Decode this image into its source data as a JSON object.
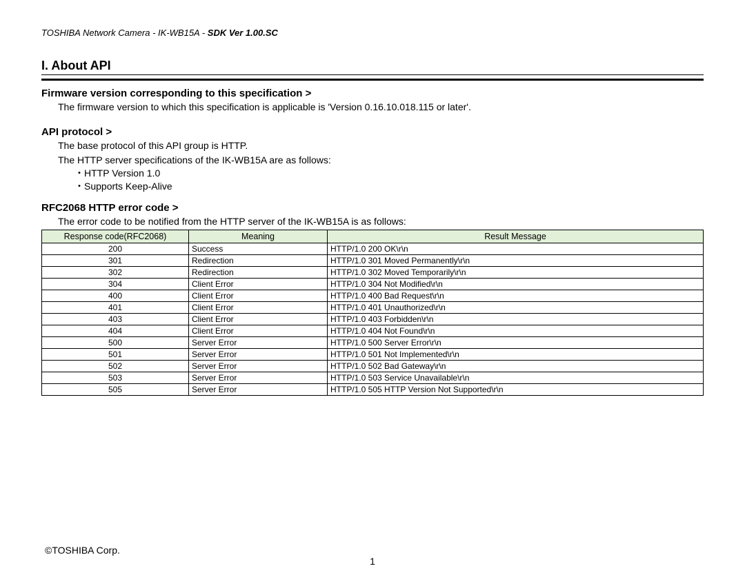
{
  "header": {
    "prefix": "TOSHIBA Network Camera - IK-WB15A -    ",
    "sdk_label": "SDK ",
    "sdk_version": "Ver 1.00.SC"
  },
  "chapter": {
    "title": "I.   About API"
  },
  "sections": {
    "firmware": {
      "title": "Firmware version corresponding to this specification >",
      "text": "The firmware version to which this specification is applicable is 'Version 0.16.10.018.115 or later'."
    },
    "api_protocol": {
      "title": "API protocol >",
      "line1": "The base protocol of this API group is HTTP.",
      "line2": "The HTTP server specifications of the IK-WB15A are as follows:",
      "bullet1": "・HTTP Version 1.0",
      "bullet2": "・Supports Keep-Alive"
    },
    "rfc2068": {
      "title": "RFC2068 HTTP error code >",
      "intro": "The error code to be notified from the HTTP server of the IK-WB15A is as follows:"
    }
  },
  "table": {
    "headers": [
      "Response code(RFC2068)",
      "Meaning",
      "Result Message"
    ],
    "rows": [
      {
        "code": "200",
        "meaning": "Success",
        "msg": "HTTP/1.0 200 OK\\r\\n"
      },
      {
        "code": "301",
        "meaning": "Redirection",
        "msg": "HTTP/1.0 301 Moved Permanently\\r\\n"
      },
      {
        "code": "302",
        "meaning": "Redirection",
        "msg": "HTTP/1.0 302 Moved Temporarily\\r\\n"
      },
      {
        "code": "304",
        "meaning": "Client Error",
        "msg": "HTTP/1.0 304 Not Modified\\r\\n"
      },
      {
        "code": "400",
        "meaning": "Client Error",
        "msg": "HTTP/1.0 400 Bad Request\\r\\n"
      },
      {
        "code": "401",
        "meaning": "Client Error",
        "msg": "HTTP/1.0 401 Unauthorized\\r\\n"
      },
      {
        "code": "403",
        "meaning": "Client Error",
        "msg": "HTTP/1.0 403 Forbidden\\r\\n"
      },
      {
        "code": "404",
        "meaning": "Client Error",
        "msg": "HTTP/1.0 404 Not Found\\r\\n"
      },
      {
        "code": "500",
        "meaning": "Server Error",
        "msg": "HTTP/1.0 500 Server Error\\r\\n"
      },
      {
        "code": "501",
        "meaning": "Server Error",
        "msg": "HTTP/1.0 501 Not Implemented\\r\\n"
      },
      {
        "code": "502",
        "meaning": "Server Error",
        "msg": "HTTP/1.0 502 Bad Gateway\\r\\n"
      },
      {
        "code": "503",
        "meaning": "Server Error",
        "msg": "HTTP/1.0 503 Service Unavailable\\r\\n"
      },
      {
        "code": "505",
        "meaning": "Server Error",
        "msg": "HTTP/1.0 505 HTTP Version Not Supported\\r\\n"
      }
    ]
  },
  "footer": {
    "copyright": "©TOSHIBA Corp.",
    "page_number": "1"
  }
}
